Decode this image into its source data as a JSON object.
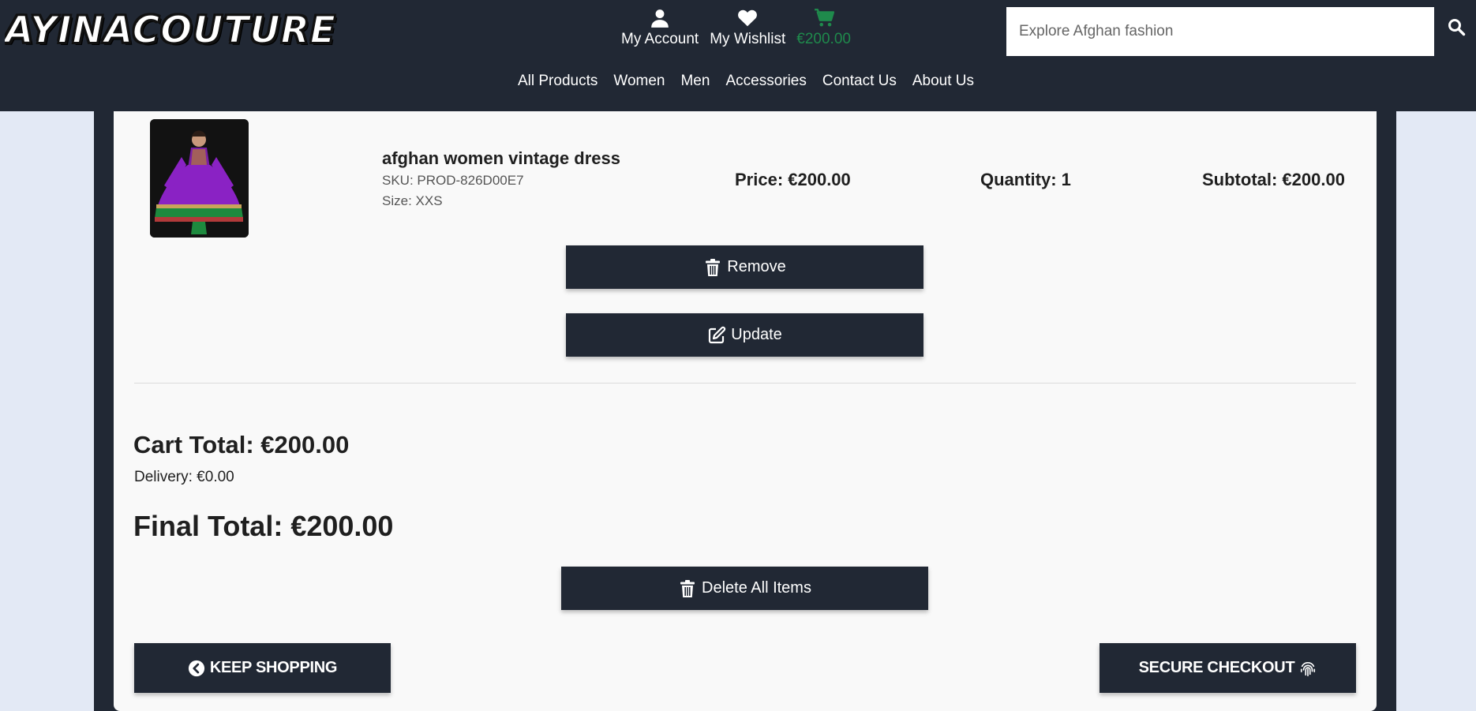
{
  "header": {
    "logo_text": "AYINACOUTURE",
    "account_label": "My Account",
    "wishlist_label": "My Wishlist",
    "bag_total": "€200.00",
    "search_placeholder": "Explore Afghan fashion"
  },
  "nav": {
    "items": [
      "All Products",
      "Women",
      "Men",
      "Accessories",
      "Contact Us",
      "About Us"
    ]
  },
  "cart_item": {
    "name": "afghan women vintage dress",
    "sku": "SKU: PROD-826D00E7",
    "size": "Size: XXS",
    "price": "Price: €200.00",
    "quantity": "Quantity: 1",
    "subtotal": "Subtotal: €200.00",
    "remove_label": "Remove",
    "update_label": "Update"
  },
  "totals": {
    "cart_total": "Cart Total: €200.00",
    "delivery": "Delivery: €0.00",
    "final_total": "Final Total: €200.00",
    "delete_all_label": "Delete All Items"
  },
  "actions": {
    "keep_shopping_label": "KEEP SHOPPING",
    "checkout_label": "SECURE CHECKOUT"
  },
  "colors": {
    "header_bg": "#212834",
    "accent_green": "#1f8a4c",
    "page_bg": "#e3e9f5",
    "card_bg": "#f9f9f9"
  },
  "icons": {
    "account": "user-icon",
    "wishlist": "heart-icon",
    "bag": "shopping-cart-icon",
    "search": "search-icon",
    "remove": "trash-icon",
    "update": "edit-icon",
    "keep_shopping": "chevron-left-circle-icon",
    "checkout": "fingerprint-icon"
  }
}
